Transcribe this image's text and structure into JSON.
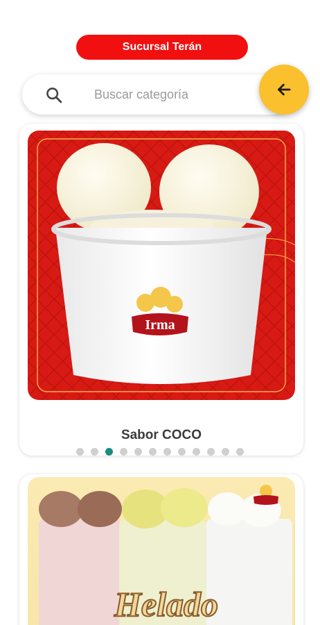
{
  "header": {
    "branch_label": "Sucursal Terán"
  },
  "search": {
    "placeholder": "Buscar categoría",
    "value": ""
  },
  "icons": {
    "search": "search-icon",
    "back": "arrow-back-icon"
  },
  "colors": {
    "brand_red": "#f20f0f",
    "accent_yellow": "#fbc02d",
    "active_dot": "#1e8b80",
    "inactive_dot": "#cfcfcf"
  },
  "cards": [
    {
      "title": "Sabor COCO",
      "brand": "Irma",
      "carousel": {
        "count": 12,
        "active_index": 2
      }
    },
    {
      "title": "",
      "banner_text": "Helado",
      "brand": "Irma"
    }
  ]
}
